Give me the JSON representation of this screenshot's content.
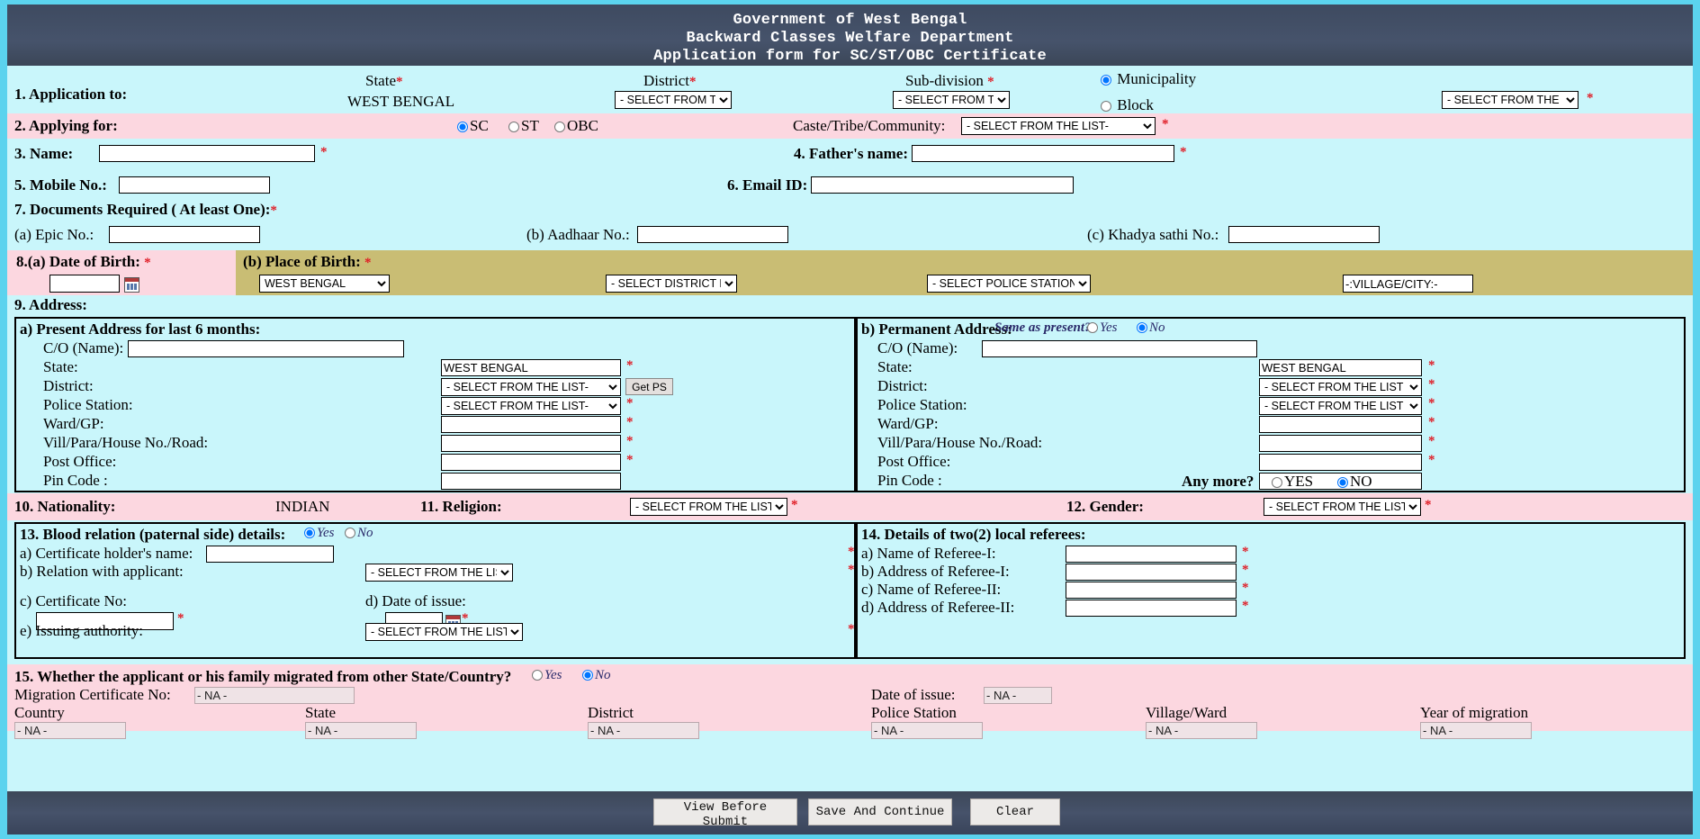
{
  "header": {
    "line1": "Government of West Bengal",
    "line2": "Backward Classes Welfare Department",
    "line3": "Application form for SC/ST/OBC Certificate"
  },
  "colors": {
    "page_bg": "#5bd3ee",
    "band_cyan": "#c9f6fb",
    "band_pink": "#fcd7e0",
    "band_khaki": "#c9bd74",
    "header_bg": "#3e4a60",
    "required": "#e01b24"
  },
  "s1": {
    "label": "1. Application to:",
    "state_label": "State",
    "state_value": "WEST BENGAL",
    "district_label": "District",
    "district_value": "- SELECT FROM THE LIST -",
    "subdivision_label": "Sub-division",
    "subdivision_value": "- SELECT FROM THE LIST -",
    "municipality_label": "Municipality",
    "block_label": "Block",
    "office_value": "- SELECT FROM THE LIST -",
    "star": "*"
  },
  "s2": {
    "label": "2. Applying for:",
    "sc": "SC",
    "st": "ST",
    "obc": "OBC",
    "caste_label": "Caste/Tribe/Community:",
    "caste_value": "- SELECT FROM THE LIST-"
  },
  "s3": {
    "label": "3. Name:",
    "value": ""
  },
  "s4": {
    "label": "4. Father's name:",
    "value": ""
  },
  "s5": {
    "label": "5. Mobile No.:",
    "value": ""
  },
  "s6": {
    "label": "6. Email ID:",
    "value": ""
  },
  "s7": {
    "label": "7. Documents Required ( At least One):",
    "epic_label": "(a) Epic No.:",
    "epic_value": "",
    "aadhaar_label": "(b) Aadhaar No.:",
    "aadhaar_value": "",
    "khadya_label": "(c) Khadya sathi No.:",
    "khadya_value": ""
  },
  "s8": {
    "dob_label": "8.(a) Date of Birth:",
    "dob_value": "",
    "pob_label": "(b) Place of Birth:",
    "pob_state": "WEST BENGAL",
    "pob_district": "- SELECT DISTRICT FROM THE LIST -",
    "pob_ps": "- SELECT POLICE STATION FROM THE LIST -",
    "pob_village": "-:VILLAGE/CITY:-"
  },
  "s9": {
    "label": "9. Address:",
    "present": {
      "title": "a) Present Address for last 6 months:",
      "rows": [
        {
          "label": "C/O (Name):",
          "value": "",
          "type": "text-wide",
          "req": false
        },
        {
          "label": "State:",
          "value": "WEST BENGAL",
          "type": "text",
          "req": true
        },
        {
          "label": "District:",
          "value": "- SELECT FROM THE LIST-",
          "type": "select",
          "req": false
        },
        {
          "label": "Police Station:",
          "value": "- SELECT FROM THE LIST-",
          "type": "select",
          "req": true
        },
        {
          "label": "Ward/GP:",
          "value": "",
          "type": "text",
          "req": true
        },
        {
          "label": "Vill/Para/House No./Road:",
          "value": "",
          "type": "text",
          "req": true
        },
        {
          "label": "Post Office:",
          "value": "",
          "type": "text",
          "req": true
        },
        {
          "label": "Pin Code :",
          "value": "",
          "type": "text",
          "req": false
        }
      ],
      "get_ps": "Get PS"
    },
    "permanent": {
      "title": "b) Permanent Address:",
      "same_as_present": "Same as present?",
      "yes": "Yes",
      "no": "No",
      "rows": [
        {
          "label": "C/O (Name):",
          "value": "",
          "type": "text-wide",
          "req": false
        },
        {
          "label": "State:",
          "value": "WEST BENGAL",
          "type": "text",
          "req": true
        },
        {
          "label": "District:",
          "value": "- SELECT FROM THE LIST -",
          "type": "select",
          "req": true
        },
        {
          "label": "Police Station:",
          "value": "- SELECT FROM THE LIST -",
          "type": "select",
          "req": true
        },
        {
          "label": "Ward/GP:",
          "value": "",
          "type": "text",
          "req": true
        },
        {
          "label": "Vill/Para/House No./Road:",
          "value": "",
          "type": "text",
          "req": true
        },
        {
          "label": "Post Office:",
          "value": "",
          "type": "text",
          "req": true
        },
        {
          "label": "Pin Code :",
          "value": "",
          "type": "text",
          "req": false
        }
      ],
      "any_more": "Any more?",
      "any_more_yes": "YES",
      "any_more_no": "NO"
    }
  },
  "s10": {
    "label": "10. Nationality:",
    "value": "INDIAN"
  },
  "s11": {
    "label": "11. Religion:",
    "value": "- SELECT FROM THE LIST -"
  },
  "s12": {
    "label": "12. Gender:",
    "value": "- SELECT FROM THE LIST -"
  },
  "s13": {
    "label": "13. Blood relation (paternal side) details:",
    "yes": "Yes",
    "no": "No",
    "a_label": "a) Certificate holder's name:",
    "a_value": "",
    "b_label": "b) Relation with applicant:",
    "b_value": "- SELECT FROM THE LIST -",
    "c_label": "c) Certificate No:",
    "c_value": "",
    "d_label": "d) Date of issue:",
    "d_value": "",
    "e_label": "e) Issuing authority:",
    "e_value": "- SELECT FROM THE LIST -"
  },
  "s14": {
    "label": "14. Details of two(2) local referees:",
    "rows": [
      {
        "label": "a) Name of Referee-I:",
        "value": ""
      },
      {
        "label": "b) Address of Referee-I:",
        "value": ""
      },
      {
        "label": "c) Name of Referee-II:",
        "value": ""
      },
      {
        "label": "d) Address of Referee-II:",
        "value": ""
      }
    ]
  },
  "s15": {
    "label": "15. Whether the applicant or his family migrated from other State/Country?",
    "yes": "Yes",
    "no": "No",
    "mig_cert_label": "Migration Certificate No:",
    "mig_cert_value": "- NA -",
    "date_label": "Date of issue:",
    "date_value": "- NA -",
    "country_label": "Country",
    "country_value": "- NA -",
    "state_label": "State",
    "state_value": "- NA -",
    "district_label": "District",
    "district_value": "- NA -",
    "ps_label": "Police Station",
    "ps_value": "- NA -",
    "village_label": "Village/Ward",
    "village_value": "- NA -",
    "year_label": "Year of migration",
    "year_value": "- NA -"
  },
  "footer": {
    "view": "View Before Submit",
    "save": "Save And Continue",
    "clear": "Clear"
  }
}
